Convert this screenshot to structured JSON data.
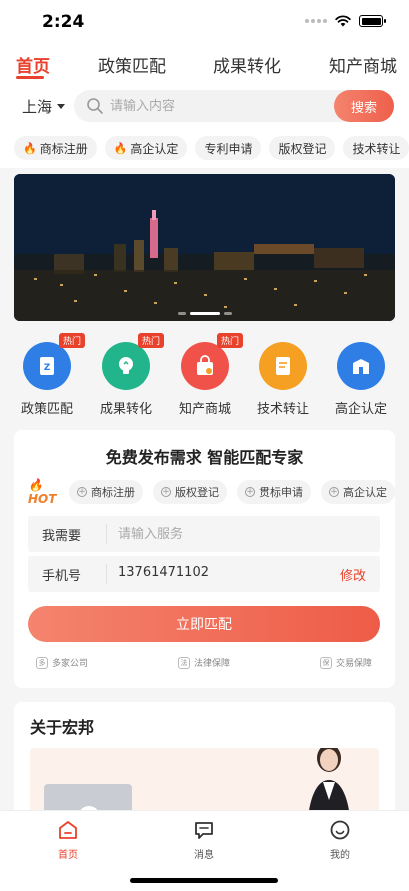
{
  "status_bar": {
    "time": "2:24"
  },
  "top_tabs": [
    {
      "label": "首页",
      "active": true
    },
    {
      "label": "政策匹配"
    },
    {
      "label": "成果转化"
    },
    {
      "label": "知产商城"
    }
  ],
  "location": {
    "city": "上海"
  },
  "search": {
    "placeholder": "请输入内容",
    "button_label": "搜索"
  },
  "quick_tags": [
    {
      "label": "商标注册",
      "hot": true
    },
    {
      "label": "高企认定",
      "hot": true
    },
    {
      "label": "专利申请"
    },
    {
      "label": "版权登记"
    },
    {
      "label": "技术转让"
    }
  ],
  "grid": {
    "hot_badge": "热门",
    "items": [
      {
        "label": "政策匹配",
        "color": "#2f7ee6",
        "icon": "policy-icon",
        "hot": true
      },
      {
        "label": "成果转化",
        "color": "#22b48a",
        "icon": "bulb-icon",
        "hot": true
      },
      {
        "label": "知产商城",
        "color": "#f0524a",
        "icon": "shopping-bag-icon",
        "hot": true
      },
      {
        "label": "技术转让",
        "color": "#f5a022",
        "icon": "document-icon"
      },
      {
        "label": "高企认定",
        "color": "#2f7ee6",
        "icon": "building-icon"
      }
    ]
  },
  "match_card": {
    "title": "免费发布需求  智能匹配专家",
    "hot_logo": "HOT",
    "chips": [
      "商标注册",
      "版权登记",
      "贯标申请",
      "高企认定"
    ],
    "need_label": "我需要",
    "need_placeholder": "请输入服务",
    "phone_label": "手机号",
    "phone_value": "13761471102",
    "modify_label": "修改",
    "submit_label": "立即匹配",
    "guarantees": [
      "多家公司",
      "法律保障",
      "交易保障"
    ]
  },
  "about": {
    "title": "关于宏邦"
  },
  "bottom_tabs": [
    {
      "label": "首页",
      "active": true,
      "icon": "home-icon"
    },
    {
      "label": "消息",
      "icon": "message-icon"
    },
    {
      "label": "我的",
      "icon": "profile-icon"
    }
  ],
  "colors": {
    "accent": "#e8412c",
    "button_gradient_start": "#f4846e"
  }
}
